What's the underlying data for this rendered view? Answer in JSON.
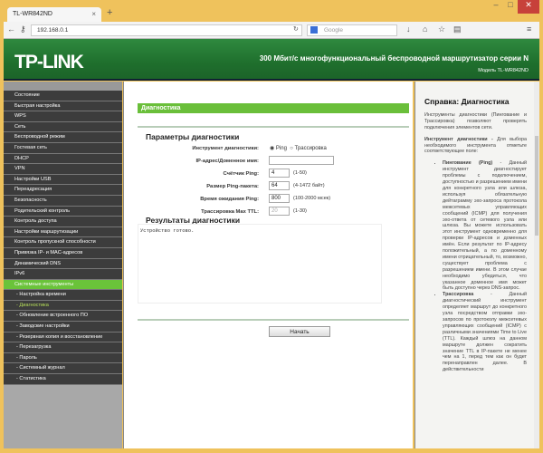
{
  "browser": {
    "tab_title": "TL-WR842ND",
    "new_tab": "+",
    "url": "192.168.0.1",
    "search_placeholder": "Google",
    "minimize": "–",
    "maximize": "□",
    "close": "✕"
  },
  "banner": {
    "logo": "TP-LINK",
    "title": "300 Мбит/с многофункциональный беспроводной маршрутизатор серии N",
    "model": "Модель TL-WR842ND"
  },
  "sidebar": {
    "items": [
      {
        "label": "Состояние"
      },
      {
        "label": "Быстрая настройка"
      },
      {
        "label": "WPS"
      },
      {
        "label": "Сеть"
      },
      {
        "label": "Беспроводной режим"
      },
      {
        "label": "Гостевая сеть"
      },
      {
        "label": "DHCP"
      },
      {
        "label": "VPN"
      },
      {
        "label": "Настройки USB"
      },
      {
        "label": "Переадресация"
      },
      {
        "label": "Безопасность"
      },
      {
        "label": "Родительский контроль"
      },
      {
        "label": "Контроль доступа"
      },
      {
        "label": "Настройки маршрутизации"
      },
      {
        "label": "Контроль пропускной способности"
      },
      {
        "label": "Привязка IP- и MAC-адресов"
      },
      {
        "label": "Динамический DNS"
      },
      {
        "label": "IPv6"
      },
      {
        "label": "Системные инструменты"
      }
    ],
    "subitems": [
      {
        "label": "- Настройка времени"
      },
      {
        "label": "- Диагностика"
      },
      {
        "label": "- Обновление встроенного ПО"
      },
      {
        "label": "- Заводские настройки"
      },
      {
        "label": "- Резервная копия и восстановление"
      },
      {
        "label": "- Перезагрузка"
      },
      {
        "label": "- Пароль"
      },
      {
        "label": "- Системный журнал"
      },
      {
        "label": "- Статистика"
      }
    ]
  },
  "main": {
    "header": "Диагностика",
    "params_title": "Параметры диагностики",
    "tool_label": "Инструмент диагностики:",
    "opt_ping": "Ping",
    "opt_trace": "Трассировка",
    "selected": "Ping",
    "ip_label": "IP-адрес/Доменное имя:",
    "ip_value": "",
    "count_label": "Счётчик Ping:",
    "count_value": "4",
    "count_hint": "(1-50)",
    "size_label": "Размер Ping-пакета:",
    "size_value": "64",
    "size_hint": "(4-1472 байт)",
    "timeout_label": "Время ожидания Ping:",
    "timeout_value": "800",
    "timeout_hint": "(100-2000 мсек)",
    "ttl_label": "Трассировка Max TTL:",
    "ttl_value": "20",
    "ttl_hint": "(1-30)",
    "results_title": "Результаты диагностики",
    "results_text": "Устройство готово.",
    "start_button": "Начать"
  },
  "help": {
    "title": "Справка: Диагностика",
    "intro": "Инструменты диагностики (Пингование и Трассировка) позволяют проверять подключения элементов сети.",
    "tool_term": "Инструмент диагностики -",
    "tool_desc": " Для выбора необходимого инструмента отметьте соответствующее поле:",
    "ping_term": "Пингование (Ping)",
    "ping_desc": " - Данный инструмент диагностирует проблемы с подключением, доступностью и разрешением имени для конкретного узла или шлюза, используя обязательную дейтаграмму эхо-запроса протокола межсетевых управляющих сообщений (ICMP) для получения эхо-ответа от сетевого узла или шлюза. Вы можете использовать этот инструмент одновременно для проверки IP-адресов и доменных имён. Если результат по IP-адресу положительный, а по доменному имени отрицательный, то, возможно, существует проблема с разрешением имени. В этом случае необходимо убедиться, что указанное доменное имя может быть доступно через DNS-запрос.",
    "trace_term": "Трассировка",
    "trace_desc": " - Данный диагностический инструмент определяет маршрут до конкретного узла посредством отправки эхо-запросов по протоколу межсетевых управляющих сообщений (ICMP) с различными значениями Time to Live (TTL). Каждый шлюз на данном маршруте должен сократить значение TTL в IP-пакете не менее чем на 1, перед тем как он будет перенаправлен далее. В действительности"
  }
}
